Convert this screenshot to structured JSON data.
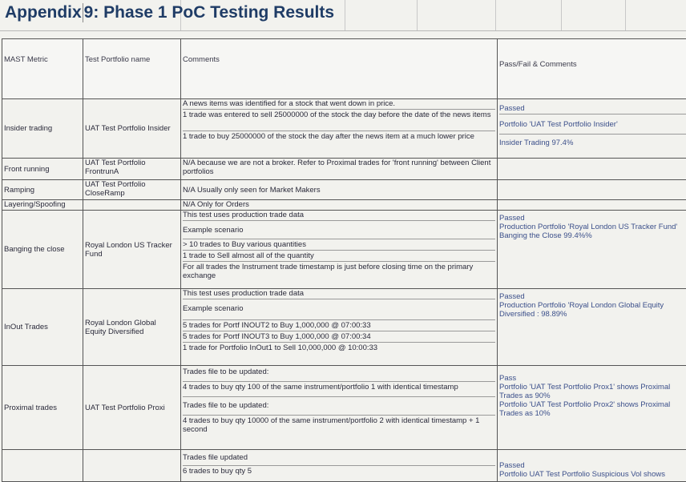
{
  "title": {
    "part1": "Appendix",
    "part2": "9: Phase 1 PoC Testing Results"
  },
  "headers": {
    "metric": "MAST Metric",
    "portfolio": "Test Portfolio name",
    "comments": "Comments",
    "passfail": "Pass/Fail & Comments"
  },
  "rows": [
    {
      "metric": "Insider trading",
      "portfolio": "UAT Test Portfolio Insider",
      "comments": [
        "A news items was identified for a stock that went down in price.",
        "1 trade was entered to sell 25000000 of the stock the day before the date of the news items",
        "1 trade to buy 25000000 of the stock the day after the news item at a much lower price"
      ],
      "passfail": [
        "Passed",
        "Portfolio 'UAT Test Portfolio Insider'",
        "Insider Trading 97.4%"
      ]
    },
    {
      "metric": "Front running",
      "portfolio": "UAT Test Portfolio FrontrunA",
      "comments": [
        "N/A because we are not a broker. Refer to Proximal trades for 'front running' between Client portfolios"
      ],
      "passfail": []
    },
    {
      "metric": "Ramping",
      "portfolio": "UAT Test Portfolio CloseRamp",
      "comments": [
        "N/A Usually only seen for Market Makers"
      ],
      "passfail": []
    },
    {
      "metric": "Layering/Spoofing",
      "portfolio": "",
      "comments": [
        "N/A  Only for Orders"
      ],
      "passfail": []
    },
    {
      "metric": "Banging the close",
      "portfolio": "Royal London US Tracker Fund",
      "comments": [
        "This test uses production trade data",
        "Example scenario",
        "> 10 trades to Buy various quantities",
        "1 trade to Sell almost all of the quantity",
        "For all trades the Instrument trade timestamp is just before closing time on the primary exchange"
      ],
      "passfail": [
        "Passed",
        "Production Portfolio 'Royal London US Tracker Fund' Banging the Close 99.4%%"
      ]
    },
    {
      "metric": "InOut Trades",
      "portfolio": "Royal London Global Equity Diversified",
      "comments": [
        "This test uses production trade data",
        "Example scenario",
        "5 trades for Portf INOUT2 to Buy 1,000,000 @ 07:00:33",
        "5 trades for Portf INOUT3 to Buy 1,000,000 @ 07:00:34",
        "1 trade for Portfolio InOut1 to Sell 10,000,000 @ 10:00:33"
      ],
      "passfail": [
        "Passed",
        "Production Portfolio 'Royal London Global Equity Diversified : 98.89%"
      ]
    },
    {
      "metric": "Proximal trades",
      "portfolio": "UAT Test Portfolio Proxi",
      "comments": [
        "Trades file to be updated:",
        "4 trades to buy qty 100 of the same instrument/portfolio 1 with identical timestamp",
        "Trades file to be updated:",
        "4 trades to buy qty 10000 of the same instrument/portfolio 2 with identical timestamp + 1 second"
      ],
      "passfail": [
        "Pass",
        "Portfolio 'UAT Test Portfolio Prox1' shows Proximal Trades as 90%",
        "Portfolio 'UAT Test Portfolio Prox2' shows Proximal Trades as 10%"
      ]
    },
    {
      "metric": "",
      "portfolio": "",
      "comments": [
        "Trades file updated",
        "6 trades to buy qty 5"
      ],
      "passfail": [
        "Passed",
        "Portfolio UAT Test Portfolio Suspicious Vol shows"
      ]
    }
  ]
}
